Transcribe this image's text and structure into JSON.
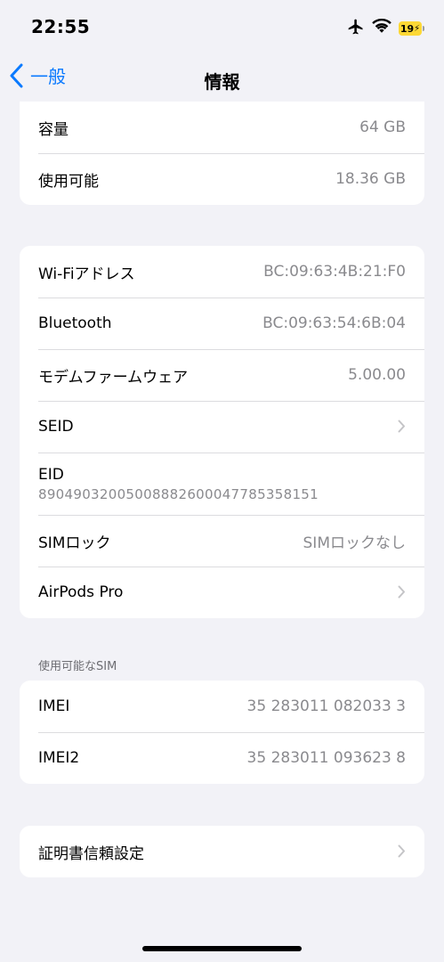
{
  "status_bar": {
    "time": "22:55",
    "battery_level": "19",
    "icons": [
      "airplane-icon",
      "wifi-icon",
      "battery-charging-icon"
    ]
  },
  "nav": {
    "back_label": "一般",
    "title": "情報"
  },
  "section_storage": {
    "rows": [
      {
        "label": "容量",
        "value": "64 GB"
      },
      {
        "label": "使用可能",
        "value": "18.36 GB"
      }
    ]
  },
  "section_network": {
    "rows": [
      {
        "label": "Wi-Fiアドレス",
        "value": "BC:09:63:4B:21:F0"
      },
      {
        "label": "Bluetooth",
        "value": "BC:09:63:54:6B:04"
      },
      {
        "label": "モデムファームウェア",
        "value": "5.00.00"
      },
      {
        "label": "SEID",
        "value": ""
      },
      {
        "label": "EID",
        "value": "89049032005008882600047785358151"
      },
      {
        "label": "SIMロック",
        "value": "SIMロックなし"
      },
      {
        "label": "AirPods Pro",
        "value": ""
      }
    ]
  },
  "section_sim": {
    "header": "使用可能なSIM",
    "rows": [
      {
        "label": "IMEI",
        "value": "35 283011 082033 3"
      },
      {
        "label": "IMEI2",
        "value": "35 283011 093623 8"
      }
    ]
  },
  "section_cert": {
    "rows": [
      {
        "label": "証明書信頼設定",
        "value": ""
      }
    ]
  },
  "colors": {
    "accent": "#0a7aff",
    "background": "#f2f2f7",
    "battery": "#fdd835"
  }
}
